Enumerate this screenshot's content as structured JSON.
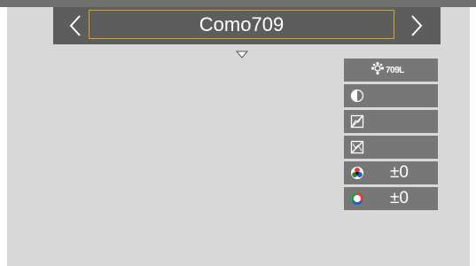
{
  "header": {
    "title": "Como709",
    "prev_icon": "chevron-left-icon",
    "next_icon": "chevron-right-icon",
    "accent_color": "#d9a21f"
  },
  "dropdown_icon": "triangle-down-icon",
  "panel": {
    "mode_label": "709L",
    "mode_icon": "photo-style-icon",
    "rows": [
      {
        "icon": "contrast-icon",
        "value": ""
      },
      {
        "icon": "highlight-icon",
        "value": ""
      },
      {
        "icon": "shadow-icon",
        "value": ""
      },
      {
        "icon": "saturation-icon",
        "value": "±0"
      },
      {
        "icon": "color-tone-icon",
        "value": "±0"
      }
    ]
  }
}
